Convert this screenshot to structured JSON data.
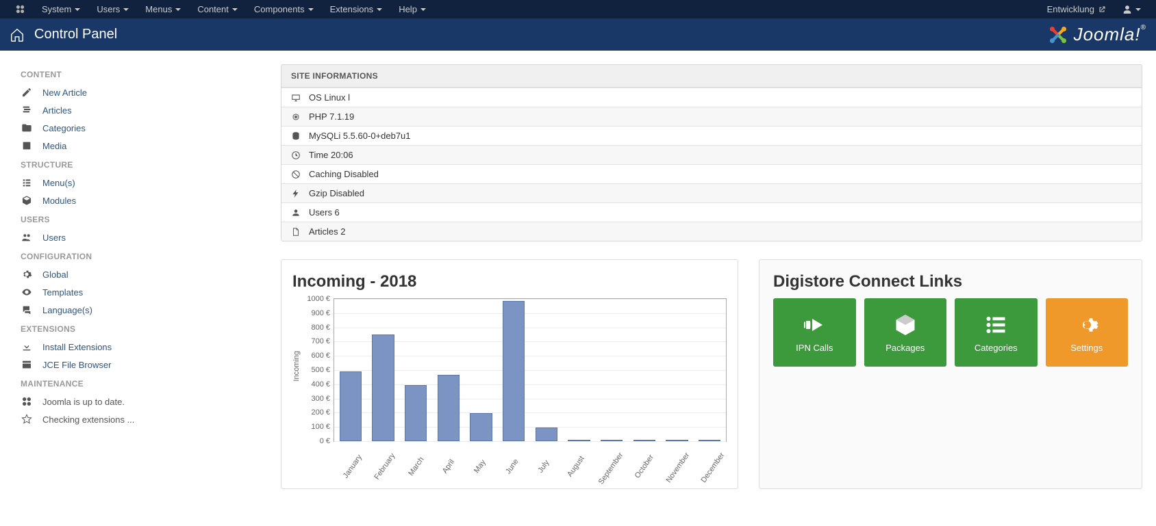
{
  "topnav": {
    "items": [
      "System",
      "Users",
      "Menus",
      "Content",
      "Components",
      "Extensions",
      "Help"
    ],
    "site_name": "Entwicklung"
  },
  "header": {
    "title": "Control Panel",
    "brand": "Joomla!"
  },
  "sidebar": {
    "groups": [
      {
        "heading": "CONTENT",
        "items": [
          {
            "icon": "pencil-icon",
            "label": "New Article"
          },
          {
            "icon": "stack-icon",
            "label": "Articles"
          },
          {
            "icon": "folder-icon",
            "label": "Categories"
          },
          {
            "icon": "image-icon",
            "label": "Media"
          }
        ]
      },
      {
        "heading": "STRUCTURE",
        "items": [
          {
            "icon": "list-icon",
            "label": "Menu(s)"
          },
          {
            "icon": "cube-icon",
            "label": "Modules"
          }
        ]
      },
      {
        "heading": "USERS",
        "items": [
          {
            "icon": "users-icon",
            "label": "Users"
          }
        ]
      },
      {
        "heading": "CONFIGURATION",
        "items": [
          {
            "icon": "gear-icon",
            "label": "Global"
          },
          {
            "icon": "eye-icon",
            "label": "Templates"
          },
          {
            "icon": "comments-icon",
            "label": "Language(s)"
          }
        ]
      },
      {
        "heading": "EXTENSIONS",
        "items": [
          {
            "icon": "download-icon",
            "label": "Install Extensions"
          },
          {
            "icon": "window-icon",
            "label": "JCE File Browser"
          }
        ]
      },
      {
        "heading": "MAINTENANCE",
        "items": [
          {
            "icon": "joomla-icon",
            "label": "Joomla is up to date.",
            "muted": true
          },
          {
            "icon": "star-icon",
            "label": "Checking extensions ...",
            "muted": true
          }
        ]
      }
    ]
  },
  "site_info": {
    "heading": "SITE INFORMATIONS",
    "rows": [
      {
        "icon": "screen-icon",
        "text": "OS Linux l"
      },
      {
        "icon": "cog-small-icon",
        "text": "PHP 7.1.19"
      },
      {
        "icon": "database-icon",
        "text": "MySQLi 5.5.60-0+deb7u1"
      },
      {
        "icon": "clock-icon",
        "text": "Time 20:06"
      },
      {
        "icon": "ban-icon",
        "text": "Caching Disabled"
      },
      {
        "icon": "bolt-icon",
        "text": "Gzip Disabled"
      },
      {
        "icon": "user-icon",
        "text": "Users 6"
      },
      {
        "icon": "file-icon",
        "text": "Articles 2"
      }
    ]
  },
  "chart_data": {
    "type": "bar",
    "title": "Incoming - 2018",
    "ylabel": "Incoming",
    "xlabel": "",
    "ylim": [
      0,
      1000
    ],
    "y_tick_step": 100,
    "y_tick_suffix": " €",
    "categories": [
      "January",
      "February",
      "March",
      "April",
      "May",
      "June",
      "July",
      "August",
      "September",
      "October",
      "November",
      "December"
    ],
    "values": [
      490,
      750,
      395,
      465,
      195,
      985,
      95,
      5,
      5,
      5,
      5,
      5
    ]
  },
  "digistore": {
    "heading": "Digistore Connect Links",
    "tiles": [
      {
        "icon": "arrow-right-icon",
        "label": "IPN Calls",
        "color": "green"
      },
      {
        "icon": "package-icon",
        "label": "Packages",
        "color": "green"
      },
      {
        "icon": "list-big-icon",
        "label": "Categories",
        "color": "green"
      },
      {
        "icon": "gear-big-icon",
        "label": "Settings",
        "color": "orange"
      }
    ]
  }
}
